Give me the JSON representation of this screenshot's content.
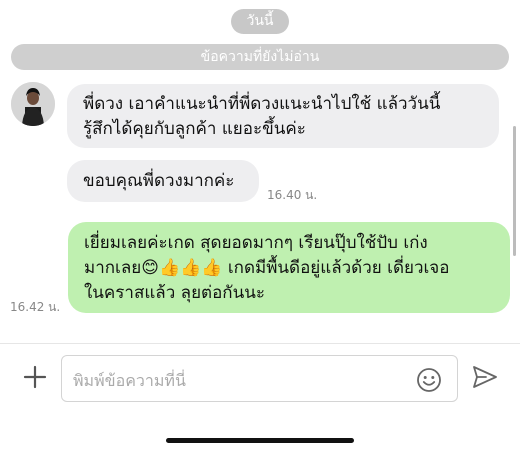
{
  "header": {
    "date_label": "วันนี้",
    "unread_label": "ข้อความที่ยังไม่อ่าน"
  },
  "messages": [
    {
      "direction": "incoming",
      "line1": "พี่ดวง เอาคำแนะนำที่พี่ดวงแนะนำไปใช้ แล้ววันนี้",
      "line2": "รู้สึกได้คุยกับลูกค้า แยอะขึ้นค่ะ",
      "time": ""
    },
    {
      "direction": "incoming",
      "line1": "ขอบคุณพี่ดวงมากค่ะ",
      "time": "16.40 น."
    },
    {
      "direction": "outgoing",
      "line1": "เยี่ยมเลยค่ะเกด  สุดยอดมากๆ เรียนปุ๊บใช้ปับ เก่ง",
      "line2a": "มากเลย",
      "emojis": "😊👍👍👍",
      "line2b": "  เกดมีพื้นดีอยู่แล้วด้วย  เดี่ยวเจอ",
      "line3": "ในคราสแล้ว  ลุยต่อกันนะ",
      "time": "16.42 น."
    }
  ],
  "composer": {
    "placeholder": "พิมพ์ข้อความที่นี่",
    "plus_icon": "plus-icon",
    "emoji_icon": "smiley-icon",
    "send_icon": "send-icon"
  },
  "colors": {
    "incoming_bubble": "#eeeef0",
    "outgoing_bubble": "#bff0b0",
    "pill": "#c8c8c8"
  }
}
